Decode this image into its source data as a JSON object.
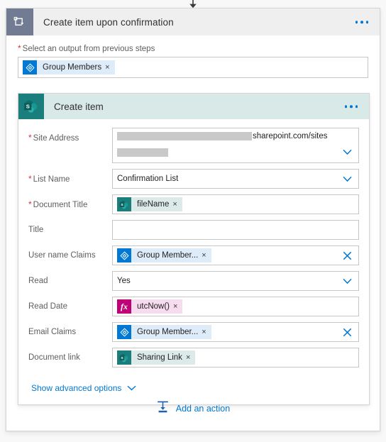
{
  "flow": {
    "incoming_arrow": "arrow-down",
    "foreach": {
      "icon": "apply-to-each-icon",
      "title": "Create item upon confirmation",
      "menu": "ellipsis-menu",
      "input_label": "Select an output from previous steps",
      "required_marker": "*",
      "input_token": {
        "icon": "azure-ad-icon",
        "label": "Group Members",
        "remove": "×"
      }
    },
    "action": {
      "icon": "sharepoint-icon",
      "title": "Create item",
      "menu": "ellipsis-menu",
      "fields": [
        {
          "label": "Site Address",
          "required": true,
          "type": "combobox-redacted",
          "redacted_primary": "",
          "domain_text": "sharepoint.com/sites",
          "affordance": "chevron-down-icon"
        },
        {
          "label": "List Name",
          "required": true,
          "type": "combobox",
          "value": "Confirmation List",
          "affordance": "chevron-down-icon"
        },
        {
          "label": "Document Title",
          "required": true,
          "type": "token",
          "token": {
            "icon": "sharepoint-icon",
            "label": "fileName",
            "remove": "×",
            "kind": "sp"
          },
          "affordance": "none"
        },
        {
          "label": "Title",
          "required": false,
          "type": "text",
          "value": "",
          "affordance": "none"
        },
        {
          "label": "User name Claims",
          "required": false,
          "type": "token",
          "token": {
            "icon": "azure-ad-icon",
            "label": "Group Member...",
            "remove": "×",
            "kind": "aad"
          },
          "affordance": "clear-icon"
        },
        {
          "label": "Read",
          "required": false,
          "type": "combobox",
          "value": "Yes",
          "affordance": "chevron-down-icon"
        },
        {
          "label": "Read Date",
          "required": false,
          "type": "token",
          "token": {
            "icon": "expression-fx-icon",
            "label": "utcNow()",
            "remove": "×",
            "kind": "fx"
          },
          "affordance": "none"
        },
        {
          "label": "Email Claims",
          "required": false,
          "type": "token",
          "token": {
            "icon": "azure-ad-icon",
            "label": "Group Member...",
            "remove": "×",
            "kind": "aad"
          },
          "affordance": "clear-icon"
        },
        {
          "label": "Document link",
          "required": false,
          "type": "token",
          "token": {
            "icon": "sharepoint-icon",
            "label": "Sharing Link",
            "remove": "×",
            "kind": "sp"
          },
          "affordance": "none"
        }
      ],
      "advanced_options_label": "Show advanced options",
      "advanced_options_icon": "chevron-down-icon"
    },
    "add_action": {
      "icon": "add-action-icon",
      "label": "Add an action"
    }
  },
  "colors": {
    "accent": "#0078d4",
    "sharepoint": "#1a7f7c",
    "sharepoint_header": "#d8e9e8",
    "foreach_icon": "#717c92",
    "foreach_header": "#efefef",
    "required": "#d13438",
    "expression": "#bf0077",
    "azure_ad": "#0078d4",
    "redaction": "#c9c9c9"
  }
}
